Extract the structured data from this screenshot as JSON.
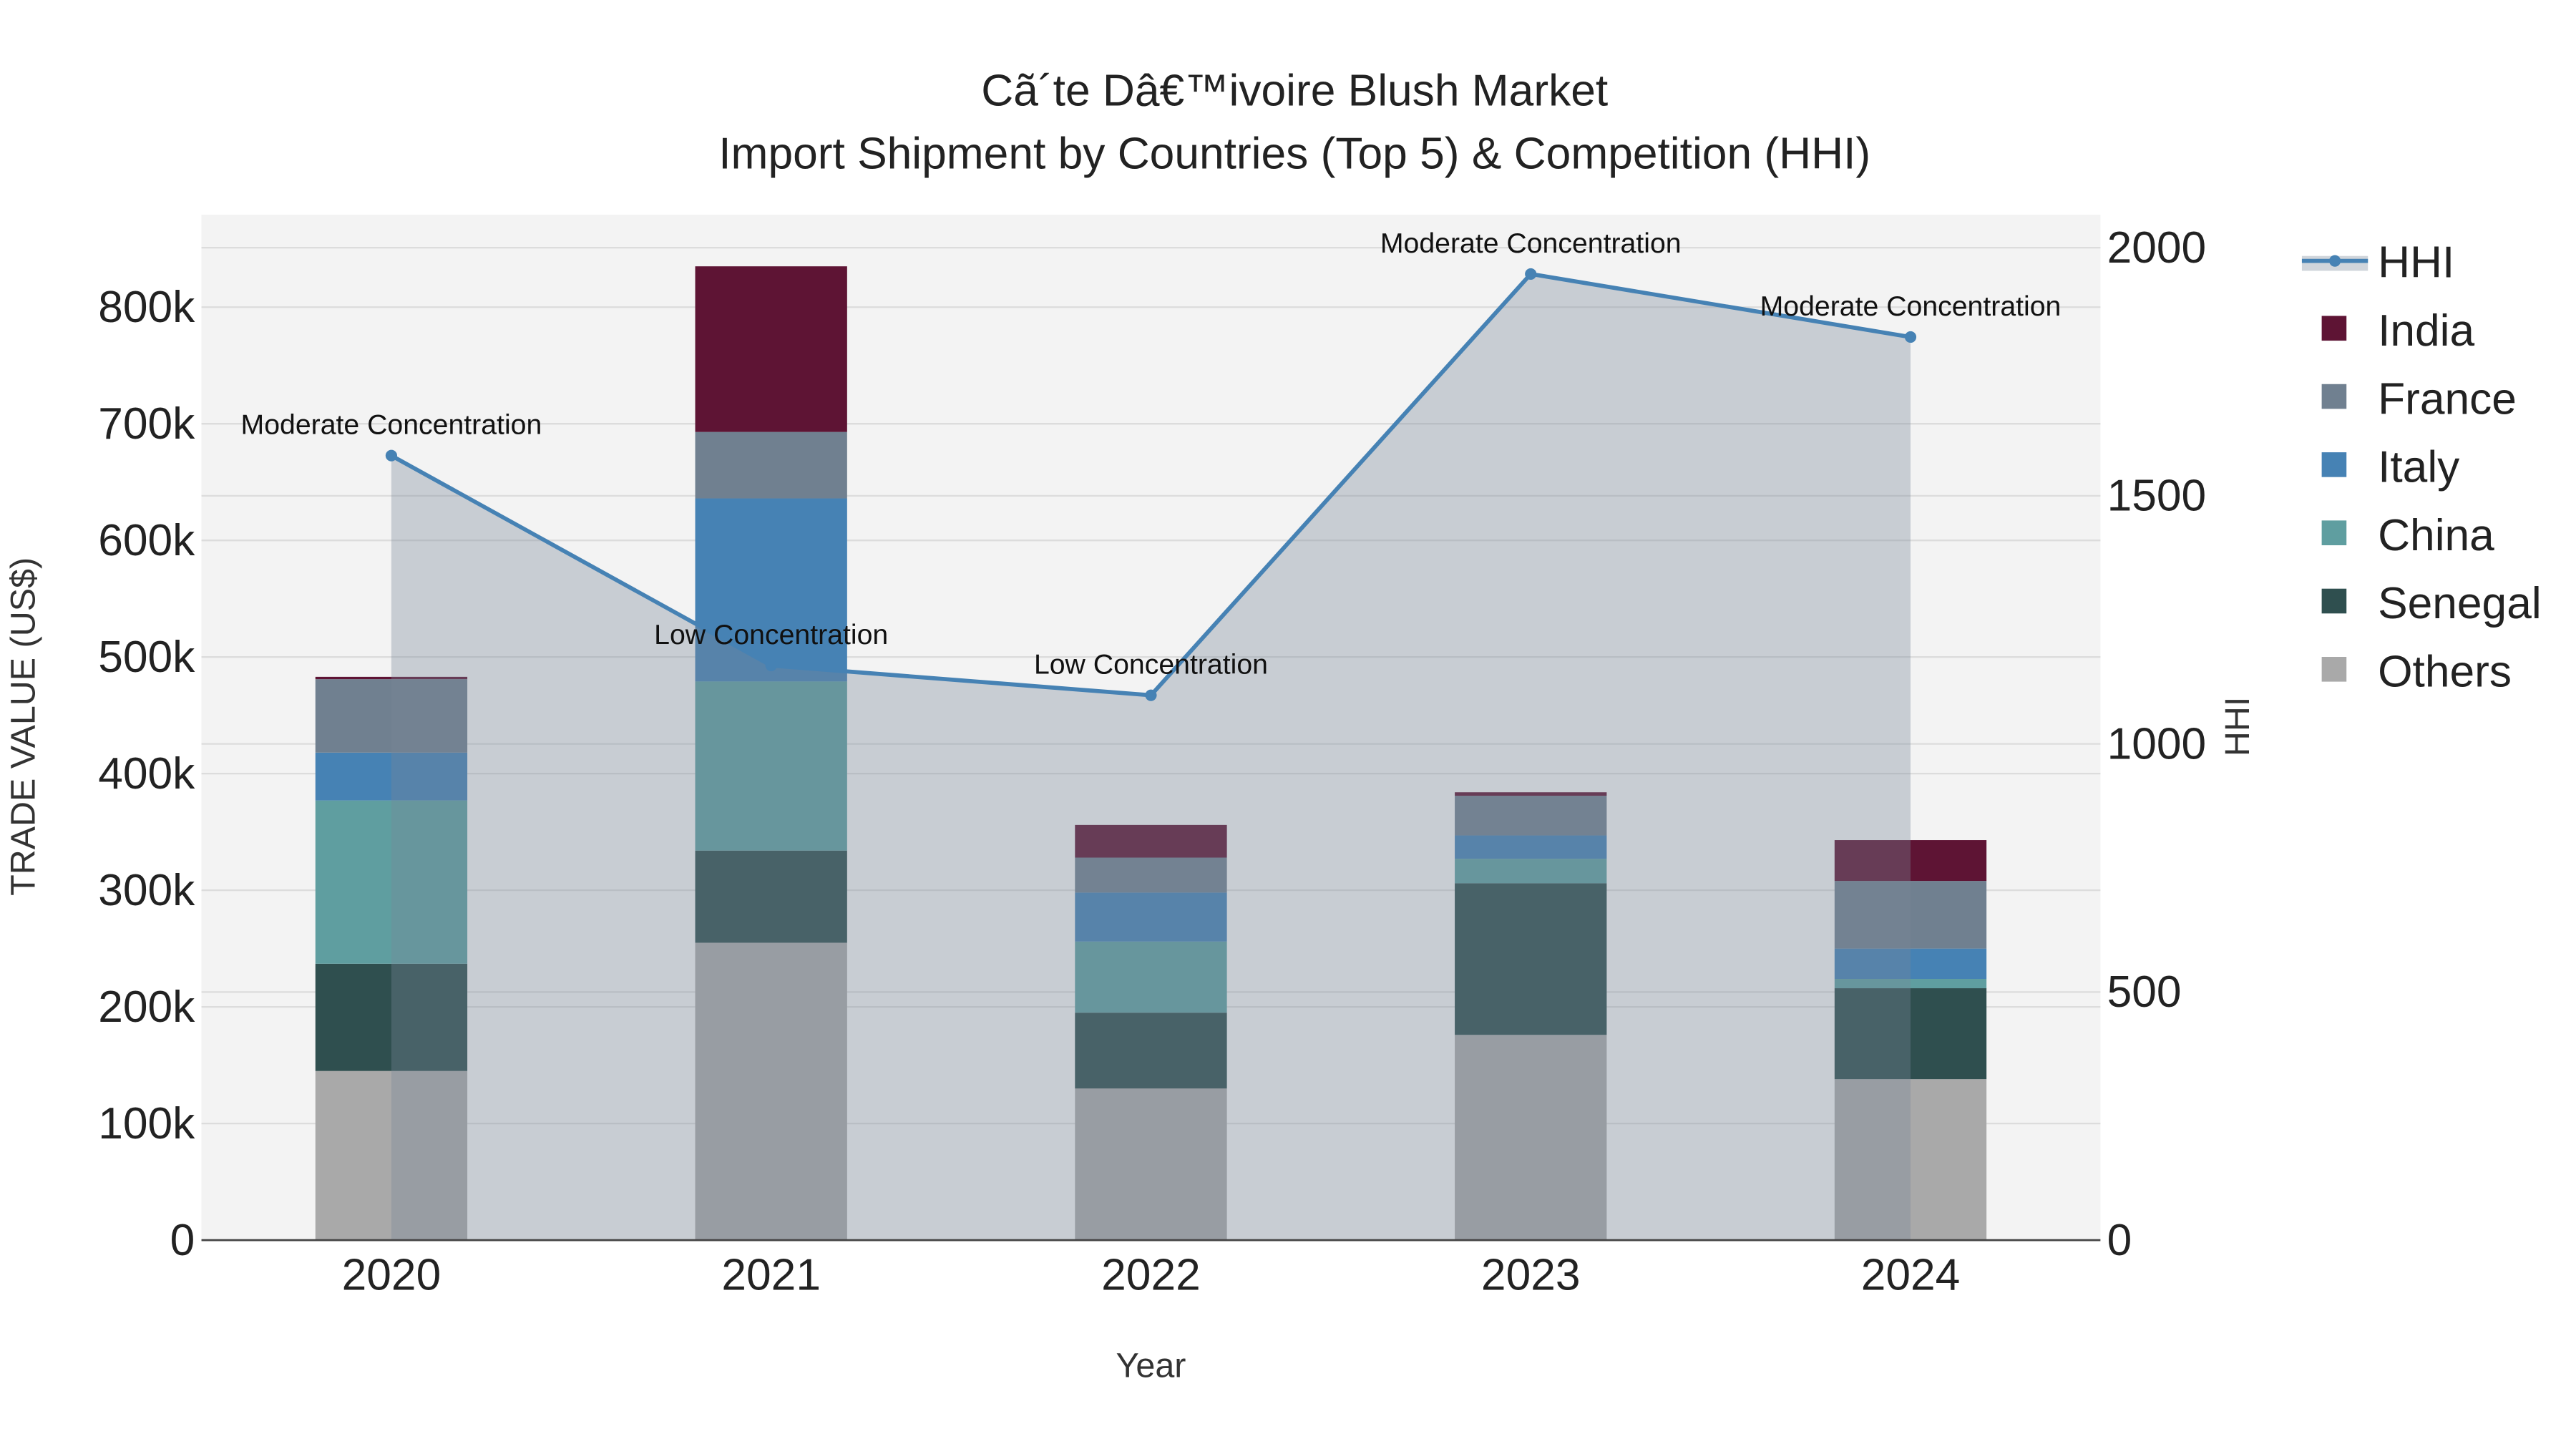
{
  "chart_data": {
    "type": "bar",
    "title": "Cã´te Dâ€™ivoire Blush Market",
    "subtitle": "Import Shipment by Countries (Top 5) & Competition (HHI)",
    "xlabel": "Year",
    "ylabel": "TRADE VALUE (US$)",
    "y2label": "HHI",
    "categories": [
      "2020",
      "2021",
      "2022",
      "2023",
      "2024"
    ],
    "ylim": [
      0,
      880000
    ],
    "y2lim": [
      0,
      2000
    ],
    "yticks": [
      0,
      100000,
      200000,
      300000,
      400000,
      500000,
      600000,
      700000,
      800000
    ],
    "ytick_labels": [
      "0",
      "100k",
      "200k",
      "300k",
      "400k",
      "500k",
      "600k",
      "700k",
      "800k"
    ],
    "y2ticks": [
      0,
      500,
      1000,
      1500,
      2000
    ],
    "y2tick_labels": [
      "0",
      "500",
      "1000",
      "1500",
      "2000"
    ],
    "barmode": "stack",
    "series": [
      {
        "name": "Others",
        "color": "#a9a9a9",
        "values": [
          145000,
          255000,
          130000,
          176000,
          138000
        ]
      },
      {
        "name": "Senegal",
        "color": "#2f4f4f",
        "values": [
          92000,
          79000,
          65000,
          130000,
          78000
        ]
      },
      {
        "name": "China",
        "color": "#5f9ea0",
        "values": [
          140000,
          145000,
          61000,
          21000,
          8000
        ]
      },
      {
        "name": "Italy",
        "color": "#4682b4",
        "values": [
          41000,
          157000,
          42000,
          20000,
          26000
        ]
      },
      {
        "name": "France",
        "color": "#708090",
        "values": [
          63000,
          57000,
          30000,
          34000,
          58000
        ]
      },
      {
        "name": "India",
        "color": "#5e1434",
        "values": [
          2000,
          142000,
          28000,
          3000,
          35000
        ]
      }
    ],
    "hhi": {
      "name": "HHI",
      "color": "#4682b4",
      "fill": "#778899",
      "values": [
        1581,
        1158,
        1098,
        1947,
        1820
      ],
      "annotations": [
        "Moderate Concentration",
        "Low Concentration",
        "Low Concentration",
        "Moderate Concentration",
        "Moderate Concentration"
      ]
    },
    "legend": {
      "placement": "right",
      "order": [
        "HHI",
        "India",
        "France",
        "Italy",
        "China",
        "Senegal",
        "Others"
      ]
    },
    "grid": true
  }
}
